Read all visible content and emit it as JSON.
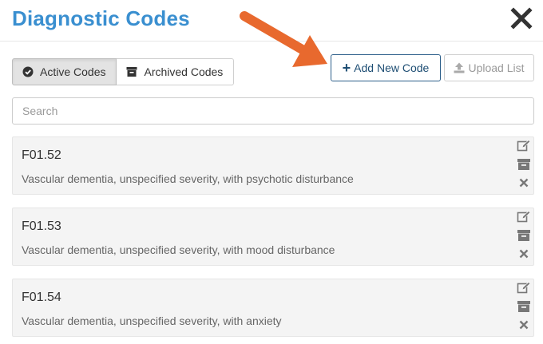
{
  "header": {
    "title": "Diagnostic Codes",
    "close_icon": "close-icon"
  },
  "tabs": [
    {
      "label": "Active Codes",
      "icon": "check-circle-icon",
      "active": true
    },
    {
      "label": "Archived Codes",
      "icon": "archive-icon",
      "active": false
    }
  ],
  "toolbar": {
    "add_label": "Add New Code",
    "add_icon": "plus-icon",
    "upload_label": "Upload List",
    "upload_icon": "upload-icon"
  },
  "search": {
    "placeholder": "Search",
    "value": ""
  },
  "codes": [
    {
      "code": "F01.52",
      "description": "Vascular dementia, unspecified severity, with psychotic disturbance"
    },
    {
      "code": "F01.53",
      "description": "Vascular dementia, unspecified severity, with mood disturbance"
    },
    {
      "code": "F01.54",
      "description": "Vascular dementia, unspecified severity, with anxiety"
    }
  ],
  "row_actions": [
    "edit-icon",
    "archive-icon",
    "delete-icon"
  ],
  "colors": {
    "title": "#3a8fd0",
    "primary_border": "#2d5f8a",
    "arrow_annotation": "#e8692e",
    "card_background": "#f4f4f4"
  }
}
